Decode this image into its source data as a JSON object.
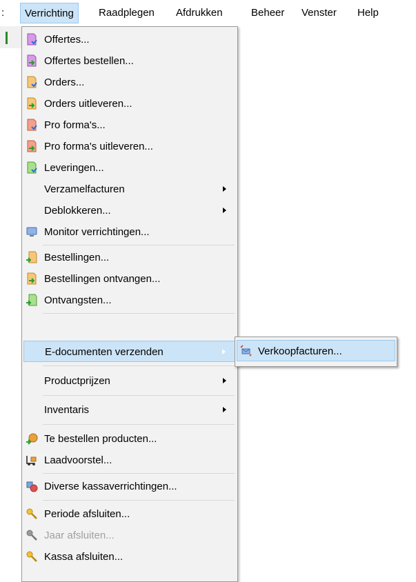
{
  "menubar": {
    "items": [
      {
        "label": ":"
      },
      {
        "label": "Verrichting"
      },
      {
        "label": "Raadplegen"
      },
      {
        "label": "Afdrukken"
      },
      {
        "label": "Beheer"
      },
      {
        "label": "Venster"
      },
      {
        "label": "Help"
      }
    ]
  },
  "dropdown": {
    "items": [
      {
        "label": "Offertes..."
      },
      {
        "label": "Offertes bestellen..."
      },
      {
        "label": "Orders..."
      },
      {
        "label": "Orders uitleveren..."
      },
      {
        "label": "Pro forma's..."
      },
      {
        "label": "Pro forma's uitleveren..."
      },
      {
        "label": "Leveringen..."
      },
      {
        "label": "Verzamelfacturen"
      },
      {
        "label": "Deblokkeren..."
      },
      {
        "label": "Monitor verrichtingen..."
      },
      {
        "label": "Bestellingen..."
      },
      {
        "label": "Bestellingen ontvangen..."
      },
      {
        "label": "Ontvangsten..."
      },
      {
        "label": "E-documenten verzenden"
      },
      {
        "label": "Productprijzen"
      },
      {
        "label": "Inventaris"
      },
      {
        "label": "Te bestellen producten..."
      },
      {
        "label": "Laadvoorstel..."
      },
      {
        "label": "Diverse kassaverrichtingen..."
      },
      {
        "label": "Periode afsluiten..."
      },
      {
        "label": "Jaar afsluiten..."
      },
      {
        "label": "Kassa afsluiten..."
      }
    ]
  },
  "submenu": {
    "items": [
      {
        "label": "Verkoopfacturen..."
      }
    ]
  },
  "colors": {
    "highlight": "#cce4f7",
    "highlight_border": "#99c9ef",
    "menu_bg": "#f2f2f2",
    "disabled_text": "#a0a0a0"
  }
}
